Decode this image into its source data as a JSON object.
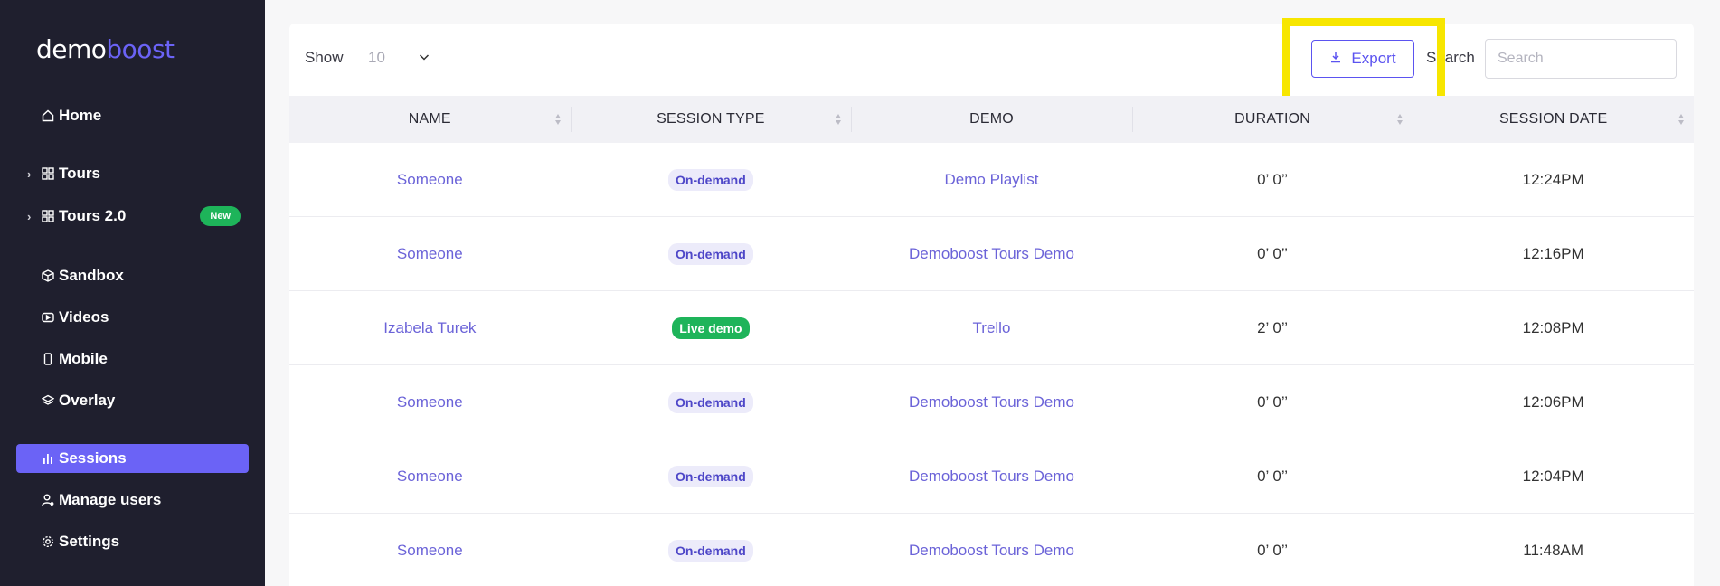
{
  "brand": {
    "part1": "demo",
    "part2": "boost"
  },
  "sidebar": {
    "items": [
      {
        "label": "Home",
        "icon": "home-icon"
      },
      {
        "label": "Tours",
        "icon": "grid-icon",
        "expandable": true
      },
      {
        "label": "Tours 2.0",
        "icon": "grid-icon",
        "expandable": true,
        "badge": "New"
      },
      {
        "label": "Sandbox",
        "icon": "cube-icon"
      },
      {
        "label": "Videos",
        "icon": "video-icon"
      },
      {
        "label": "Mobile",
        "icon": "mobile-icon"
      },
      {
        "label": "Overlay",
        "icon": "layers-icon"
      },
      {
        "label": "Sessions",
        "icon": "bar-chart-icon",
        "active": true
      },
      {
        "label": "Manage users",
        "icon": "user-gear-icon"
      },
      {
        "label": "Settings",
        "icon": "gear-icon"
      }
    ]
  },
  "toolbar": {
    "show_label": "Show",
    "show_value": "10",
    "export_label": "Export",
    "search_label": "Search",
    "search_placeholder": "Search"
  },
  "table": {
    "columns": [
      "NAME",
      "SESSION TYPE",
      "DEMO",
      "DURATION",
      "SESSION DATE"
    ],
    "rows": [
      {
        "name": "Someone",
        "type": "On-demand",
        "demo": "Demo Playlist",
        "duration": "0’ 0’’",
        "date": "12:24PM"
      },
      {
        "name": "Someone",
        "type": "On-demand",
        "demo": "Demoboost Tours Demo",
        "duration": "0’ 0’’",
        "date": "12:16PM"
      },
      {
        "name": "Izabela Turek",
        "type": "Live demo",
        "demo": "Trello",
        "duration": "2’ 0’’",
        "date": "12:08PM"
      },
      {
        "name": "Someone",
        "type": "On-demand",
        "demo": "Demoboost Tours Demo",
        "duration": "0’ 0’’",
        "date": "12:06PM"
      },
      {
        "name": "Someone",
        "type": "On-demand",
        "demo": "Demoboost Tours Demo",
        "duration": "0’ 0’’",
        "date": "12:04PM"
      },
      {
        "name": "Someone",
        "type": "On-demand",
        "demo": "Demoboost Tours Demo",
        "duration": "0’ 0’’",
        "date": "11:48AM"
      }
    ]
  },
  "colors": {
    "accent": "#6b63f6",
    "sidebar_bg": "#1f1f2e",
    "live_badge": "#1eb45a",
    "highlight": "#f7e600"
  }
}
